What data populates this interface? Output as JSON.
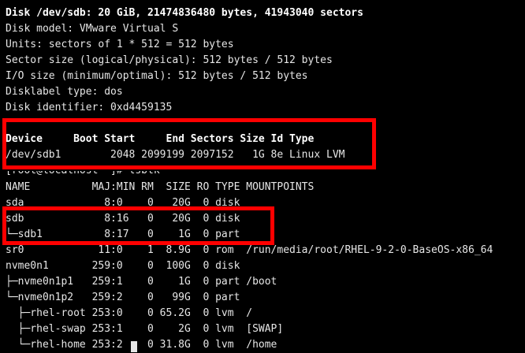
{
  "terminal": {
    "fdisk": {
      "disk_header": "Disk /dev/sdb: 20 GiB, 21474836480 bytes, 41943040 sectors",
      "disk_model": "Disk model: VMware Virtual S",
      "units": "Units: sectors of 1 * 512 = 512 bytes",
      "sector_size": "Sector size (logical/physical): 512 bytes / 512 bytes",
      "io_size": "I/O size (minimum/optimal): 512 bytes / 512 bytes",
      "disklabel": "Disklabel type: dos",
      "identifier": "Disk identifier: 0xd4459135",
      "table_header": "Device     Boot Start     End Sectors Size Id Type",
      "table_row": "/dev/sdb1        2048 2099199 2097152   1G 8e Linux LVM"
    },
    "prompt_line": "[root@localhost ~]# lsblk",
    "lsblk": {
      "header": "NAME          MAJ:MIN RM  SIZE RO TYPE MOUNTPOINTS",
      "rows": [
        "sda             8:0    0   20G  0 disk",
        "sdb             8:16   0   20G  0 disk",
        "└─sdb1          8:17   0    1G  0 part",
        "sr0            11:0    1  8.9G  0 rom  /run/media/root/RHEL-9-2-0-BaseOS-x86_64",
        "nvme0n1       259:0    0  100G  0 disk",
        "├─nvme0n1p1   259:1    0    1G  0 part /boot",
        "└─nvme0n1p2   259:2    0   99G  0 part",
        "  ├─rhel-root 253:0    0 65.2G  0 lvm  /",
        "  ├─rhel-swap 253:1    0    2G  0 lvm  [SWAP]",
        "  └─rhel-home 253:2    0 31.8G  0 lvm  /home"
      ]
    }
  },
  "colors": {
    "background": "#000000",
    "text": "#e6e6e6",
    "highlight": "#ff0000"
  }
}
